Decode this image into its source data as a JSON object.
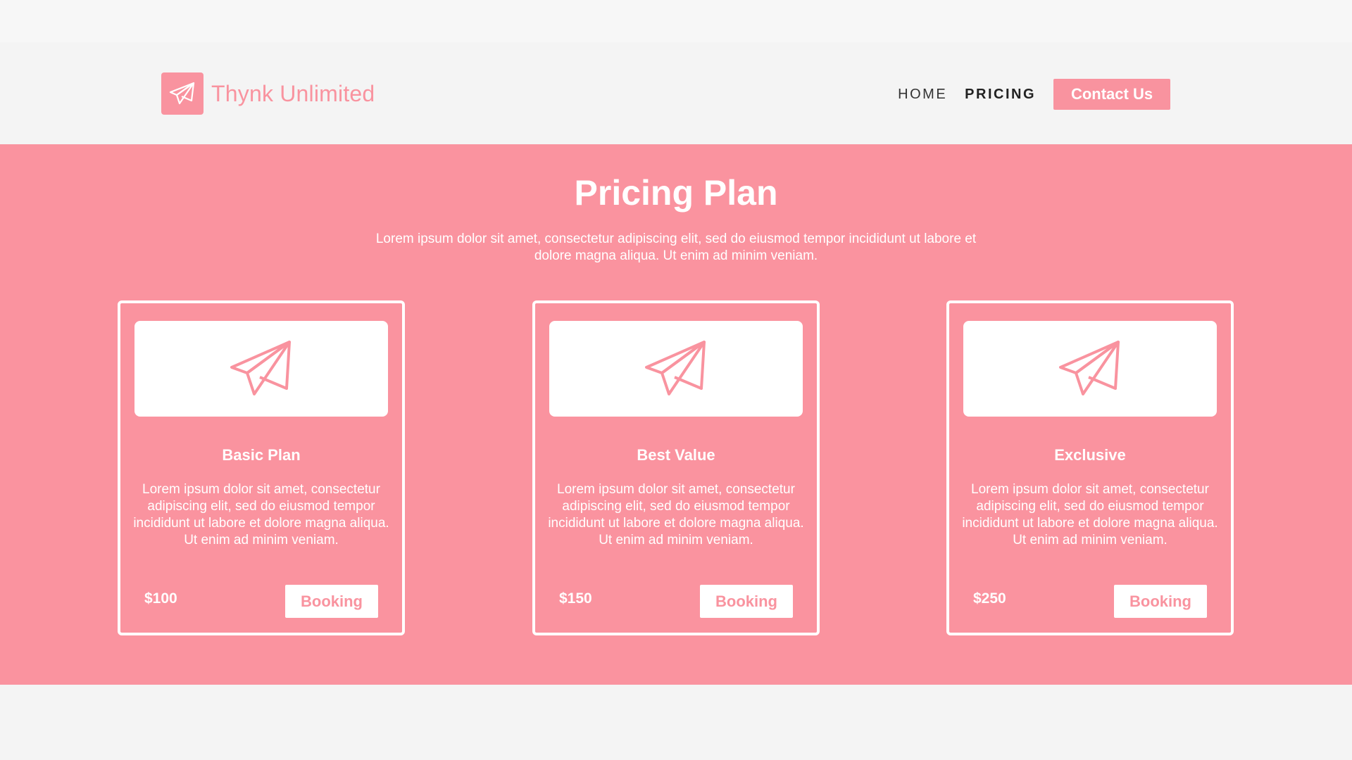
{
  "header": {
    "brand_name": "Thynk Unlimited",
    "brand_icon": "paper-plane-icon",
    "nav": [
      {
        "label": "HOME"
      },
      {
        "label": "PRICING"
      }
    ],
    "contact_label": "Contact Us"
  },
  "pricing": {
    "title": "Pricing Plan",
    "subtitle": "Lorem ipsum dolor sit amet, consectetur adipiscing elit, sed do eiusmod tempor incididunt ut labore et dolore magna aliqua. Ut enim ad minim veniam.",
    "plans": [
      {
        "name": "Basic Plan",
        "description": "Lorem ipsum dolor sit amet, consectetur adipiscing elit, sed do eiusmod tempor incididunt ut labore et dolore magna aliqua. Ut enim ad minim veniam.",
        "price": "$100",
        "button": "Booking",
        "icon": "paper-plane-icon"
      },
      {
        "name": "Best Value",
        "description": "Lorem ipsum dolor sit amet, consectetur adipiscing elit, sed do eiusmod tempor incididunt ut labore et dolore magna aliqua. Ut enim ad minim veniam.",
        "price": "$150",
        "button": "Booking",
        "icon": "paper-plane-icon"
      },
      {
        "name": "Exclusive",
        "description": "Lorem ipsum dolor sit amet, consectetur adipiscing elit, sed do eiusmod tempor incididunt ut labore et dolore magna aliqua. Ut enim ad minim veniam.",
        "price": "$250",
        "button": "Booking",
        "icon": "paper-plane-icon"
      }
    ]
  },
  "colors": {
    "accent": "#f9939f",
    "page_bg": "#f4f4f4",
    "text_dark": "#333333"
  }
}
